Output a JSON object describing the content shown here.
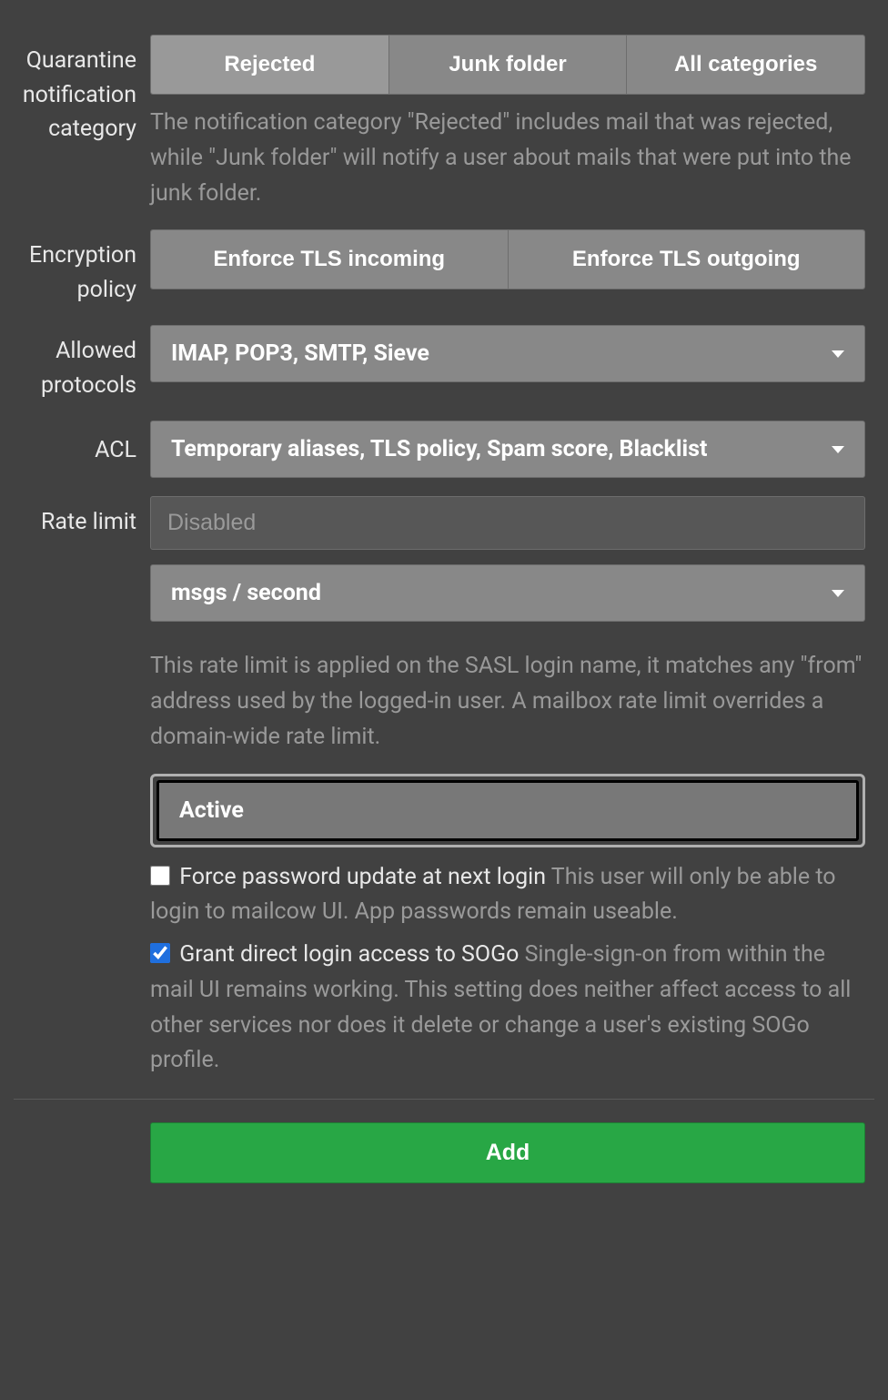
{
  "quarantine": {
    "label": "Quarantine notification category",
    "options": {
      "rejected": "Rejected",
      "junk": "Junk folder",
      "all": "All categories"
    },
    "help": "The notification category \"Rejected\" includes mail that was rejected, while \"Junk folder\" will notify a user about mails that were put into the junk folder."
  },
  "encryption": {
    "label": "Encryption policy",
    "options": {
      "in": "Enforce TLS incoming",
      "out": "Enforce TLS outgoing"
    }
  },
  "protocols": {
    "label": "Allowed protocols",
    "value": "IMAP, POP3, SMTP, Sieve"
  },
  "acl": {
    "label": "ACL",
    "value": "Temporary aliases, TLS policy, Spam score, Blacklist"
  },
  "rate": {
    "label": "Rate limit",
    "placeholder": "Disabled",
    "unit": "msgs / second",
    "help": "This rate limit is applied on the SASL login name, it matches any \"from\" address used by the logged-in user. A mailbox rate limit overrides a domain-wide rate limit."
  },
  "status": {
    "value": "Active"
  },
  "force_pw": {
    "label": "Force password update at next login",
    "help": "This user will only be able to login to mailcow UI. App passwords remain useable."
  },
  "sogo": {
    "label": "Grant direct login access to SOGo",
    "help": "Single-sign-on from within the mail UI remains working. This setting does neither affect access to all other services nor does it delete or change a user's existing SOGo profile."
  },
  "submit": {
    "label": "Add"
  }
}
